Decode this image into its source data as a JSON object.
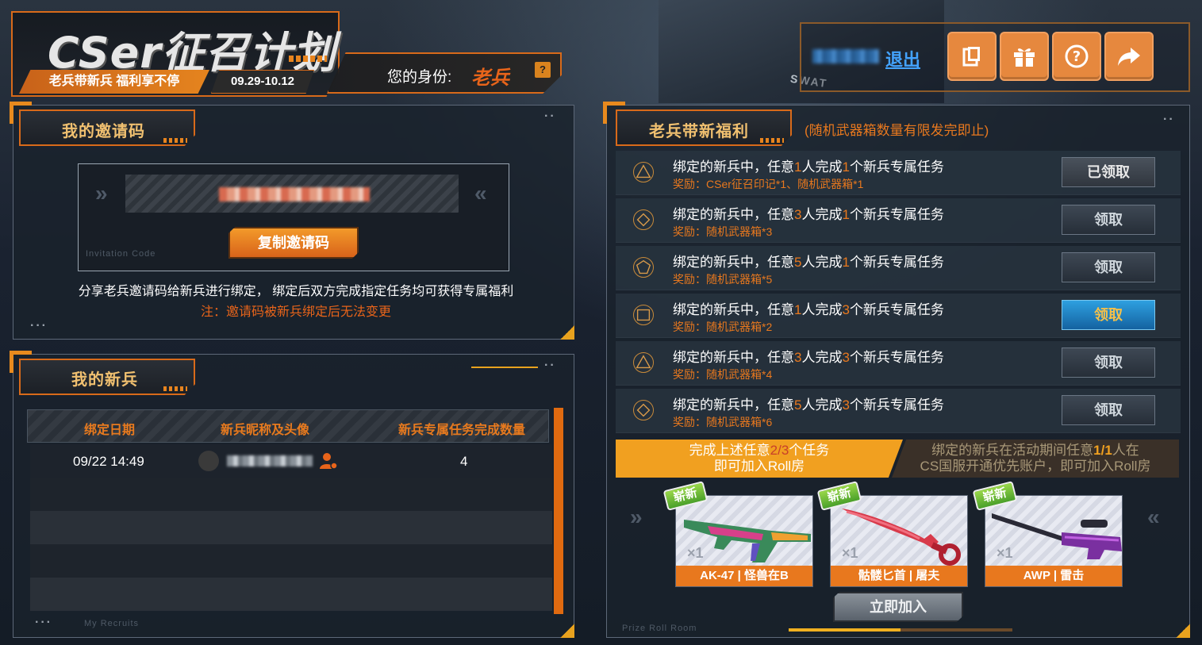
{
  "header": {
    "title": "CSer征召计划",
    "slogan": "老兵带新兵 福利享不停",
    "date_range": "09.29-10.12",
    "identity_label": "您的身份:",
    "identity_value": "老兵",
    "identity_help": "?",
    "logout": "退出"
  },
  "invite": {
    "title": "我的邀请码",
    "copy_button": "复制邀请码",
    "watermark": "Invitation Code",
    "description": "分享老兵邀请码给新兵进行绑定， 绑定后双方完成指定任务均可获得专属福利",
    "note": "注：邀请码被新兵绑定后无法变更"
  },
  "recruits": {
    "title": "我的新兵",
    "columns": [
      "绑定日期",
      "新兵昵称及头像",
      "新兵专属任务完成数量"
    ],
    "rows": [
      {
        "date": "09/22 14:49",
        "count": "4"
      }
    ],
    "watermark": "My Recruits"
  },
  "rewards": {
    "title": "老兵带新福利",
    "subtitle": "(随机武器箱数量有限发完即止)",
    "tasks": [
      {
        "prefix": "绑定的新兵中，任意",
        "people": "1",
        "mid": "人完成",
        "count": "1",
        "suffix": "个新兵专属任务",
        "reward": "奖励：CSer征召印记*1、随机武器箱*1",
        "button": "已领取",
        "state": "claimed"
      },
      {
        "prefix": "绑定的新兵中，任意",
        "people": "3",
        "mid": "人完成",
        "count": "1",
        "suffix": "个新兵专属任务",
        "reward": "奖励：随机武器箱*3",
        "button": "领取",
        "state": "disabled"
      },
      {
        "prefix": "绑定的新兵中，任意",
        "people": "5",
        "mid": "人完成",
        "count": "1",
        "suffix": "个新兵专属任务",
        "reward": "奖励：随机武器箱*5",
        "button": "领取",
        "state": "disabled"
      },
      {
        "prefix": "绑定的新兵中，任意",
        "people": "1",
        "mid": "人完成",
        "count": "3",
        "suffix": "个新兵专属任务",
        "reward": "奖励：随机武器箱*2",
        "button": "领取",
        "state": "active"
      },
      {
        "prefix": "绑定的新兵中，任意",
        "people": "3",
        "mid": "人完成",
        "count": "3",
        "suffix": "个新兵专属任务",
        "reward": "奖励：随机武器箱*4",
        "button": "领取",
        "state": "disabled"
      },
      {
        "prefix": "绑定的新兵中，任意",
        "people": "5",
        "mid": "人完成",
        "count": "3",
        "suffix": "个新兵专属任务",
        "reward": "奖励：随机武器箱*6",
        "button": "领取",
        "state": "disabled"
      }
    ],
    "roll_left_a": "完成上述任意",
    "roll_left_progress": "2/3",
    "roll_left_b": "个任务",
    "roll_left_line2": "即可加入Roll房",
    "roll_right_a": "绑定的新兵在活动期间任意",
    "roll_right_progress": "1/1",
    "roll_right_b": "人在",
    "roll_right_line2": "CS国服开通优先账户，即可加入Roll房",
    "prizes": [
      {
        "name": "AK-47 | 怪兽在B",
        "qty": "×1",
        "tag": "崭新"
      },
      {
        "name": "骷髅匕首 | 屠夫",
        "qty": "×1",
        "tag": "崭新"
      },
      {
        "name": "AWP | 雷击",
        "qty": "×1",
        "tag": "崭新"
      }
    ],
    "join_button": "立即加入",
    "watermark": "Prize Roll Room",
    "carousel_progress": 0.5
  },
  "background": {
    "swat_text": "SWAT"
  },
  "colors": {
    "accent": "#e8781e",
    "active_button": "#1f86c8",
    "link": "#43a3ff"
  }
}
